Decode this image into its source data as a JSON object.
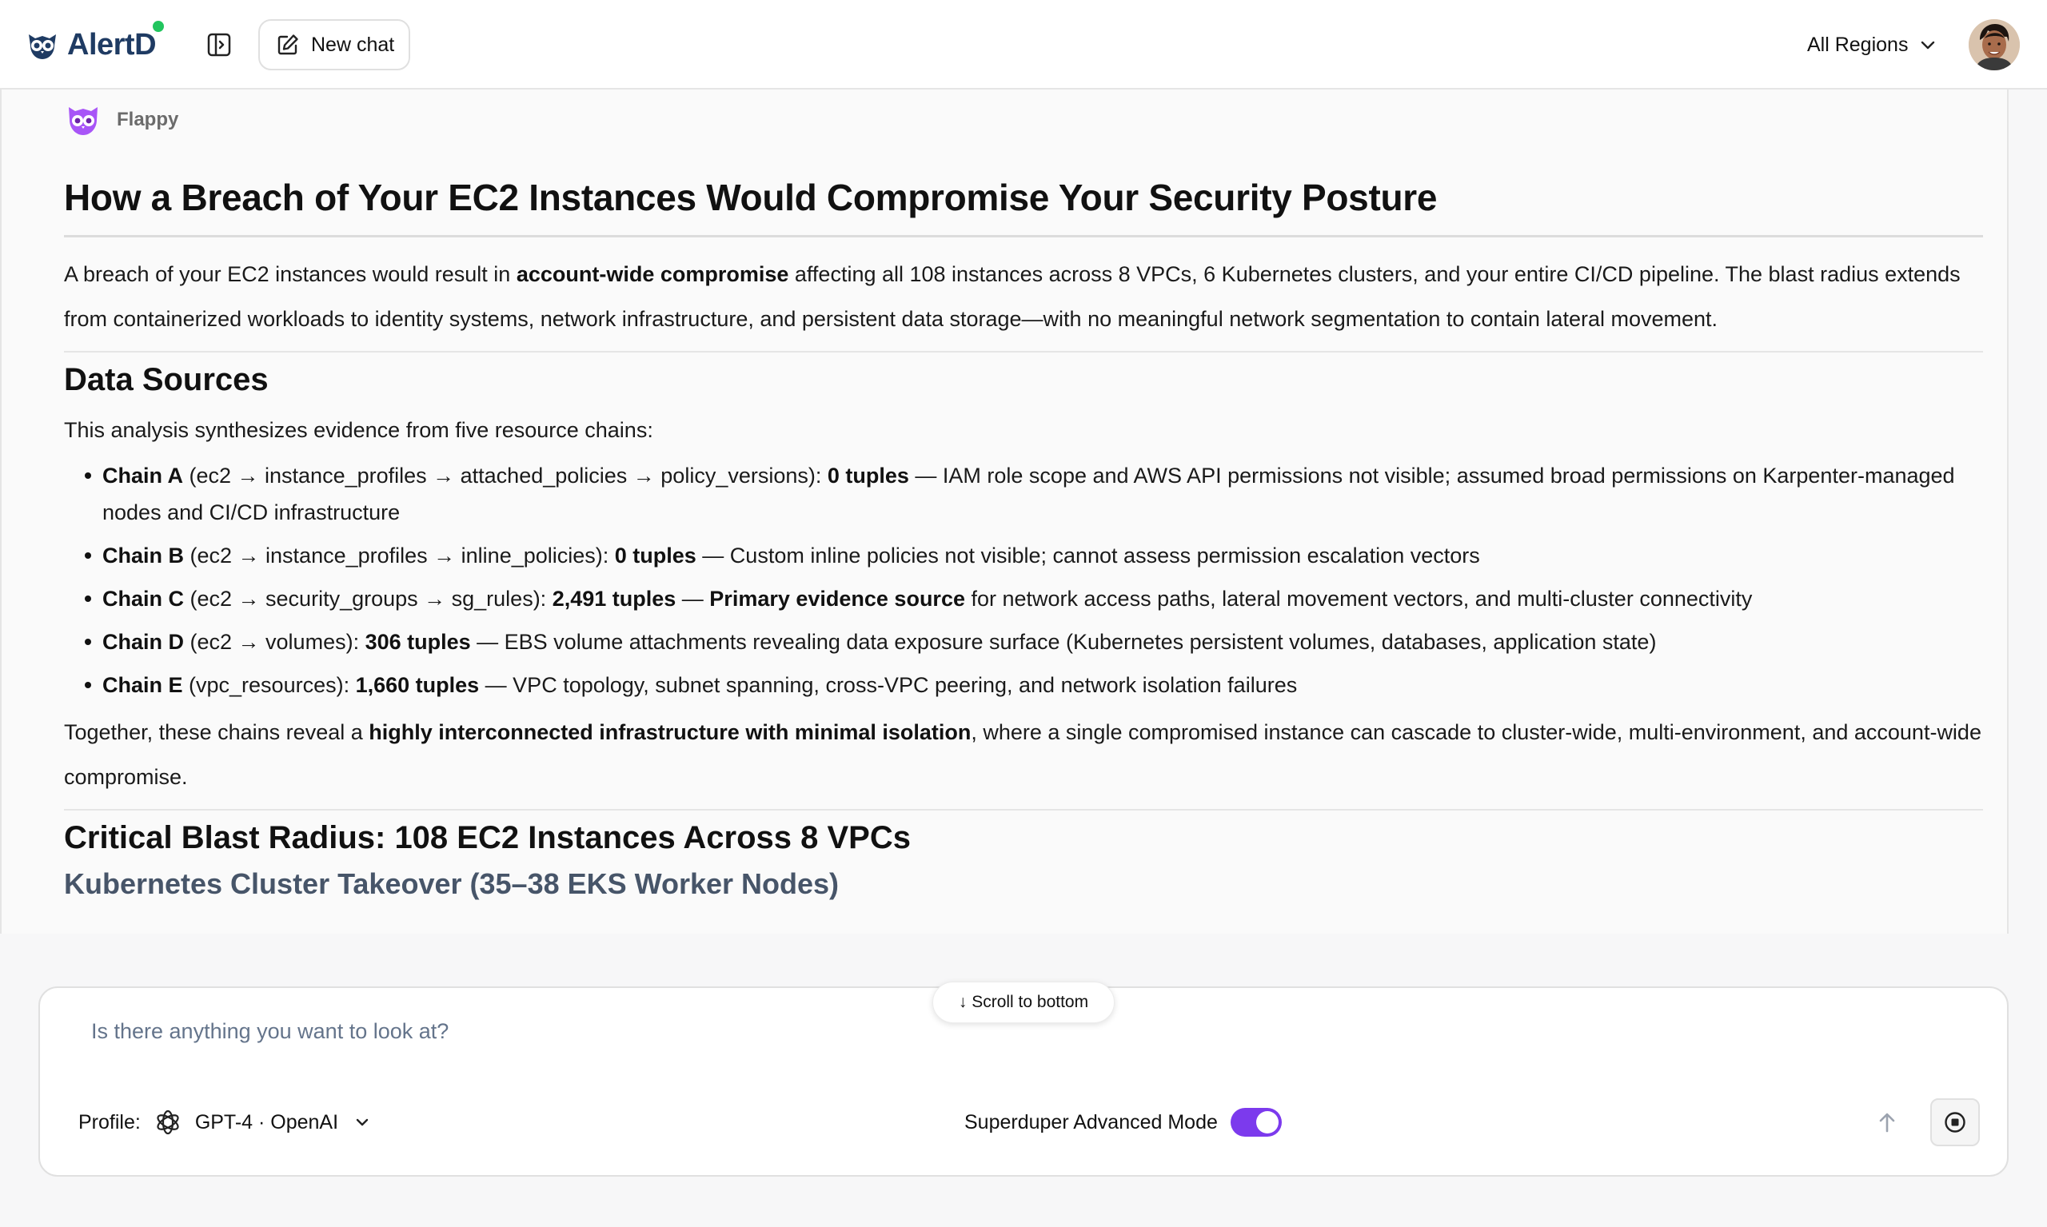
{
  "header": {
    "logo_text": "AlertD",
    "new_chat_label": "New chat",
    "region_label": "All Regions"
  },
  "message": {
    "author": "Flappy",
    "title": "How a Breach of Your EC2 Instances Would Compromise Your Security Posture",
    "intro": {
      "pre": "A breach of your EC2 instances would result in ",
      "bold": "account-wide compromise",
      "post": " affecting all 108 instances across 8 VPCs, 6 Kubernetes clusters, and your entire CI/CD pipeline. The blast radius extends from containerized workloads to identity systems, network infrastructure, and persistent data storage—with no meaningful network segmentation to contain lateral movement."
    },
    "data_sources": {
      "heading": "Data Sources",
      "lead": "This analysis synthesizes evidence from five resource chains:",
      "chains": [
        {
          "name": "Chain A",
          "path": " (ec2 → instance_profiles → attached_policies → policy_versions): ",
          "count": "0 tuples",
          "desc_bold": "",
          "desc": " — IAM role scope and AWS API permissions not visible; assumed broad permissions on Karpenter-managed nodes and CI/CD infrastructure"
        },
        {
          "name": "Chain B",
          "path": " (ec2 → instance_profiles → inline_policies): ",
          "count": "0 tuples",
          "desc_bold": "",
          "desc": " — Custom inline policies not visible; cannot assess permission escalation vectors"
        },
        {
          "name": "Chain C",
          "path": " (ec2 → security_groups → sg_rules): ",
          "count": "2,491 tuples",
          "desc_bold": "Primary evidence source",
          "desc": " for network access paths, lateral movement vectors, and multi-cluster connectivity"
        },
        {
          "name": "Chain D",
          "path": " (ec2 → volumes): ",
          "count": "306 tuples",
          "desc_bold": "",
          "desc": " — EBS volume attachments revealing data exposure surface (Kubernetes persistent volumes, databases, application state)"
        },
        {
          "name": "Chain E",
          "path": " (vpc_resources): ",
          "count": "1,660 tuples",
          "desc_bold": "",
          "desc": " — VPC topology, subnet spanning, cross-VPC peering, and network isolation failures"
        }
      ],
      "together": {
        "pre": "Together, these chains reveal a ",
        "bold": "highly interconnected infrastructure with minimal isolation",
        "post": ", where a single compromised instance can cascade to cluster-wide, multi-environment, and account-wide compromise."
      }
    },
    "blast_heading": "Critical Blast Radius: 108 EC2 Instances Across 8 VPCs",
    "k8s_heading": "Kubernetes Cluster Takeover (35–38 EKS Worker Nodes)"
  },
  "scroll_label": "↓ Scroll to bottom",
  "composer": {
    "placeholder": "Is there anything you want to look at?",
    "profile_label": "Profile:",
    "profile_value": "GPT-4 · OpenAI",
    "advanced_mode_label": "Superduper Advanced Mode",
    "advanced_mode_on": true
  },
  "colors": {
    "accent_purple": "#7c3aed",
    "status_green": "#22c55e",
    "subheading_slate": "#475569",
    "logo_navy": "#1f3b63"
  },
  "icons": {
    "sidebar_toggle": "sidebar-toggle-icon",
    "new_chat": "edit-icon",
    "region_chevron": "chevron-down-icon",
    "author_avatar": "owl-icon",
    "profile_model": "openai-icon",
    "send": "arrow-up-icon",
    "stop": "stop-icon"
  }
}
